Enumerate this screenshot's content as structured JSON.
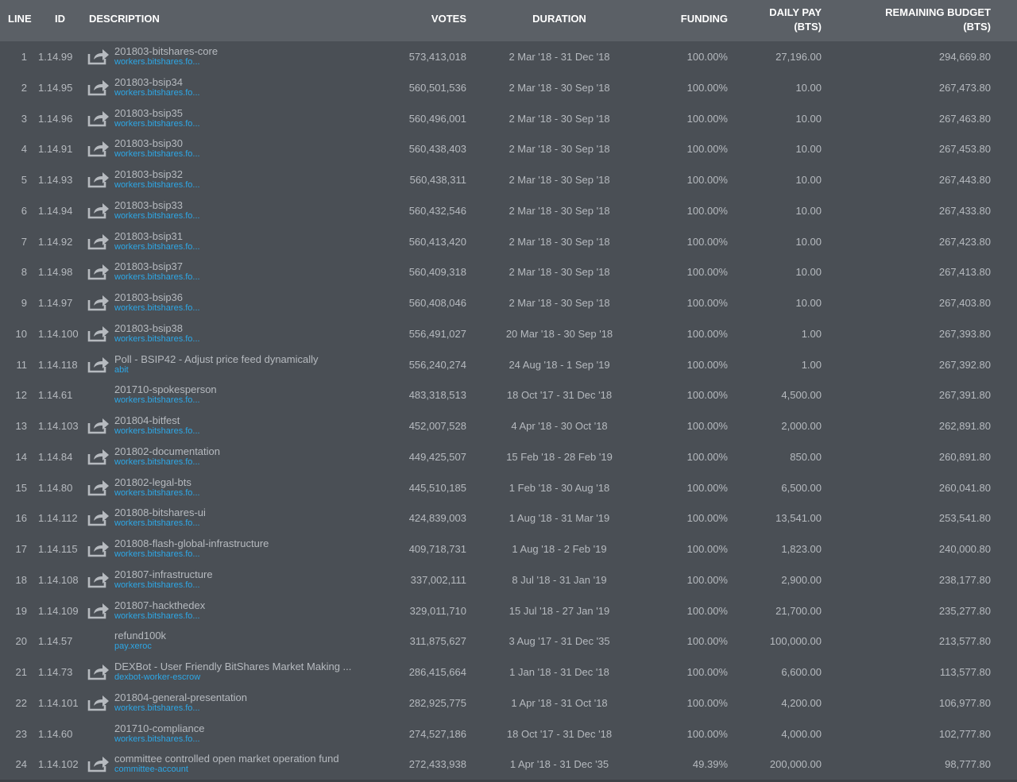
{
  "header": {
    "line": "LINE",
    "id": "ID",
    "description": "DESCRIPTION",
    "votes": "VOTES",
    "duration": "DURATION",
    "funding": "FUNDING",
    "daily_pay_1": "DAILY PAY",
    "daily_pay_2": "(BTS)",
    "remaining_1": "REMAINING BUDGET",
    "remaining_2": "(BTS)"
  },
  "rows": [
    {
      "line": "1",
      "id": "1.14.99",
      "title": "201803-bitshares-core",
      "sub": "workers.bitshares.fo...",
      "votes": "573,413,018",
      "duration": "2 Mar '18 - 31 Dec '18",
      "funding": "100.00%",
      "pay": "27,196.00",
      "remaining": "294,669.80",
      "link": true
    },
    {
      "line": "2",
      "id": "1.14.95",
      "title": "201803-bsip34",
      "sub": "workers.bitshares.fo...",
      "votes": "560,501,536",
      "duration": "2 Mar '18 - 30 Sep '18",
      "funding": "100.00%",
      "pay": "10.00",
      "remaining": "267,473.80",
      "link": true
    },
    {
      "line": "3",
      "id": "1.14.96",
      "title": "201803-bsip35",
      "sub": "workers.bitshares.fo...",
      "votes": "560,496,001",
      "duration": "2 Mar '18 - 30 Sep '18",
      "funding": "100.00%",
      "pay": "10.00",
      "remaining": "267,463.80",
      "link": true
    },
    {
      "line": "4",
      "id": "1.14.91",
      "title": "201803-bsip30",
      "sub": "workers.bitshares.fo...",
      "votes": "560,438,403",
      "duration": "2 Mar '18 - 30 Sep '18",
      "funding": "100.00%",
      "pay": "10.00",
      "remaining": "267,453.80",
      "link": true
    },
    {
      "line": "5",
      "id": "1.14.93",
      "title": "201803-bsip32",
      "sub": "workers.bitshares.fo...",
      "votes": "560,438,311",
      "duration": "2 Mar '18 - 30 Sep '18",
      "funding": "100.00%",
      "pay": "10.00",
      "remaining": "267,443.80",
      "link": true
    },
    {
      "line": "6",
      "id": "1.14.94",
      "title": "201803-bsip33",
      "sub": "workers.bitshares.fo...",
      "votes": "560,432,546",
      "duration": "2 Mar '18 - 30 Sep '18",
      "funding": "100.00%",
      "pay": "10.00",
      "remaining": "267,433.80",
      "link": true
    },
    {
      "line": "7",
      "id": "1.14.92",
      "title": "201803-bsip31",
      "sub": "workers.bitshares.fo...",
      "votes": "560,413,420",
      "duration": "2 Mar '18 - 30 Sep '18",
      "funding": "100.00%",
      "pay": "10.00",
      "remaining": "267,423.80",
      "link": true
    },
    {
      "line": "8",
      "id": "1.14.98",
      "title": "201803-bsip37",
      "sub": "workers.bitshares.fo...",
      "votes": "560,409,318",
      "duration": "2 Mar '18 - 30 Sep '18",
      "funding": "100.00%",
      "pay": "10.00",
      "remaining": "267,413.80",
      "link": true
    },
    {
      "line": "9",
      "id": "1.14.97",
      "title": "201803-bsip36",
      "sub": "workers.bitshares.fo...",
      "votes": "560,408,046",
      "duration": "2 Mar '18 - 30 Sep '18",
      "funding": "100.00%",
      "pay": "10.00",
      "remaining": "267,403.80",
      "link": true
    },
    {
      "line": "10",
      "id": "1.14.100",
      "title": "201803-bsip38",
      "sub": "workers.bitshares.fo...",
      "votes": "556,491,027",
      "duration": "20 Mar '18 - 30 Sep '18",
      "funding": "100.00%",
      "pay": "1.00",
      "remaining": "267,393.80",
      "link": true
    },
    {
      "line": "11",
      "id": "1.14.118",
      "title": "Poll - BSIP42 - Adjust price feed dynamically",
      "sub": "abit",
      "votes": "556,240,274",
      "duration": "24 Aug '18 - 1 Sep '19",
      "funding": "100.00%",
      "pay": "1.00",
      "remaining": "267,392.80",
      "link": true
    },
    {
      "line": "12",
      "id": "1.14.61",
      "title": "201710-spokesperson",
      "sub": "workers.bitshares.fo...",
      "votes": "483,318,513",
      "duration": "18 Oct '17 - 31 Dec '18",
      "funding": "100.00%",
      "pay": "4,500.00",
      "remaining": "267,391.80",
      "link": false
    },
    {
      "line": "13",
      "id": "1.14.103",
      "title": "201804-bitfest",
      "sub": "workers.bitshares.fo...",
      "votes": "452,007,528",
      "duration": "4 Apr '18 - 30 Oct '18",
      "funding": "100.00%",
      "pay": "2,000.00",
      "remaining": "262,891.80",
      "link": true
    },
    {
      "line": "14",
      "id": "1.14.84",
      "title": "201802-documentation",
      "sub": "workers.bitshares.fo...",
      "votes": "449,425,507",
      "duration": "15 Feb '18 - 28 Feb '19",
      "funding": "100.00%",
      "pay": "850.00",
      "remaining": "260,891.80",
      "link": true
    },
    {
      "line": "15",
      "id": "1.14.80",
      "title": "201802-legal-bts",
      "sub": "workers.bitshares.fo...",
      "votes": "445,510,185",
      "duration": "1 Feb '18 - 30 Aug '18",
      "funding": "100.00%",
      "pay": "6,500.00",
      "remaining": "260,041.80",
      "link": true
    },
    {
      "line": "16",
      "id": "1.14.112",
      "title": "201808-bitshares-ui",
      "sub": "workers.bitshares.fo...",
      "votes": "424,839,003",
      "duration": "1 Aug '18 - 31 Mar '19",
      "funding": "100.00%",
      "pay": "13,541.00",
      "remaining": "253,541.80",
      "link": true
    },
    {
      "line": "17",
      "id": "1.14.115",
      "title": "201808-flash-global-infrastructure",
      "sub": "workers.bitshares.fo...",
      "votes": "409,718,731",
      "duration": "1 Aug '18 - 2 Feb '19",
      "funding": "100.00%",
      "pay": "1,823.00",
      "remaining": "240,000.80",
      "link": true
    },
    {
      "line": "18",
      "id": "1.14.108",
      "title": "201807-infrastructure",
      "sub": "workers.bitshares.fo...",
      "votes": "337,002,111",
      "duration": "8 Jul '18 - 31 Jan '19",
      "funding": "100.00%",
      "pay": "2,900.00",
      "remaining": "238,177.80",
      "link": true
    },
    {
      "line": "19",
      "id": "1.14.109",
      "title": "201807-hackthedex",
      "sub": "workers.bitshares.fo...",
      "votes": "329,011,710",
      "duration": "15 Jul '18 - 27 Jan '19",
      "funding": "100.00%",
      "pay": "21,700.00",
      "remaining": "235,277.80",
      "link": true
    },
    {
      "line": "20",
      "id": "1.14.57",
      "title": "refund100k",
      "sub": "pay.xeroc",
      "votes": "311,875,627",
      "duration": "3 Aug '17 - 31 Dec '35",
      "funding": "100.00%",
      "pay": "100,000.00",
      "remaining": "213,577.80",
      "link": false
    },
    {
      "line": "21",
      "id": "1.14.73",
      "title": "DEXBot - User Friendly BitShares Market Making ...",
      "sub": "dexbot-worker-escrow",
      "votes": "286,415,664",
      "duration": "1 Jan '18 - 31 Dec '18",
      "funding": "100.00%",
      "pay": "6,600.00",
      "remaining": "113,577.80",
      "link": true
    },
    {
      "line": "22",
      "id": "1.14.101",
      "title": "201804-general-presentation",
      "sub": "workers.bitshares.fo...",
      "votes": "282,925,775",
      "duration": "1 Apr '18 - 31 Oct '18",
      "funding": "100.00%",
      "pay": "4,200.00",
      "remaining": "106,977.80",
      "link": true
    },
    {
      "line": "23",
      "id": "1.14.60",
      "title": "201710-compliance",
      "sub": "workers.bitshares.fo...",
      "votes": "274,527,186",
      "duration": "18 Oct '17 - 31 Dec '18",
      "funding": "100.00%",
      "pay": "4,000.00",
      "remaining": "102,777.80",
      "link": false
    },
    {
      "line": "24",
      "id": "1.14.102",
      "title": "committee controlled open market operation fund",
      "sub": "committee-account",
      "votes": "272,433,938",
      "duration": "1 Apr '18 - 31 Dec '35",
      "funding": "49.39%",
      "pay": "200,000.00",
      "remaining": "98,777.80",
      "link": true
    }
  ]
}
